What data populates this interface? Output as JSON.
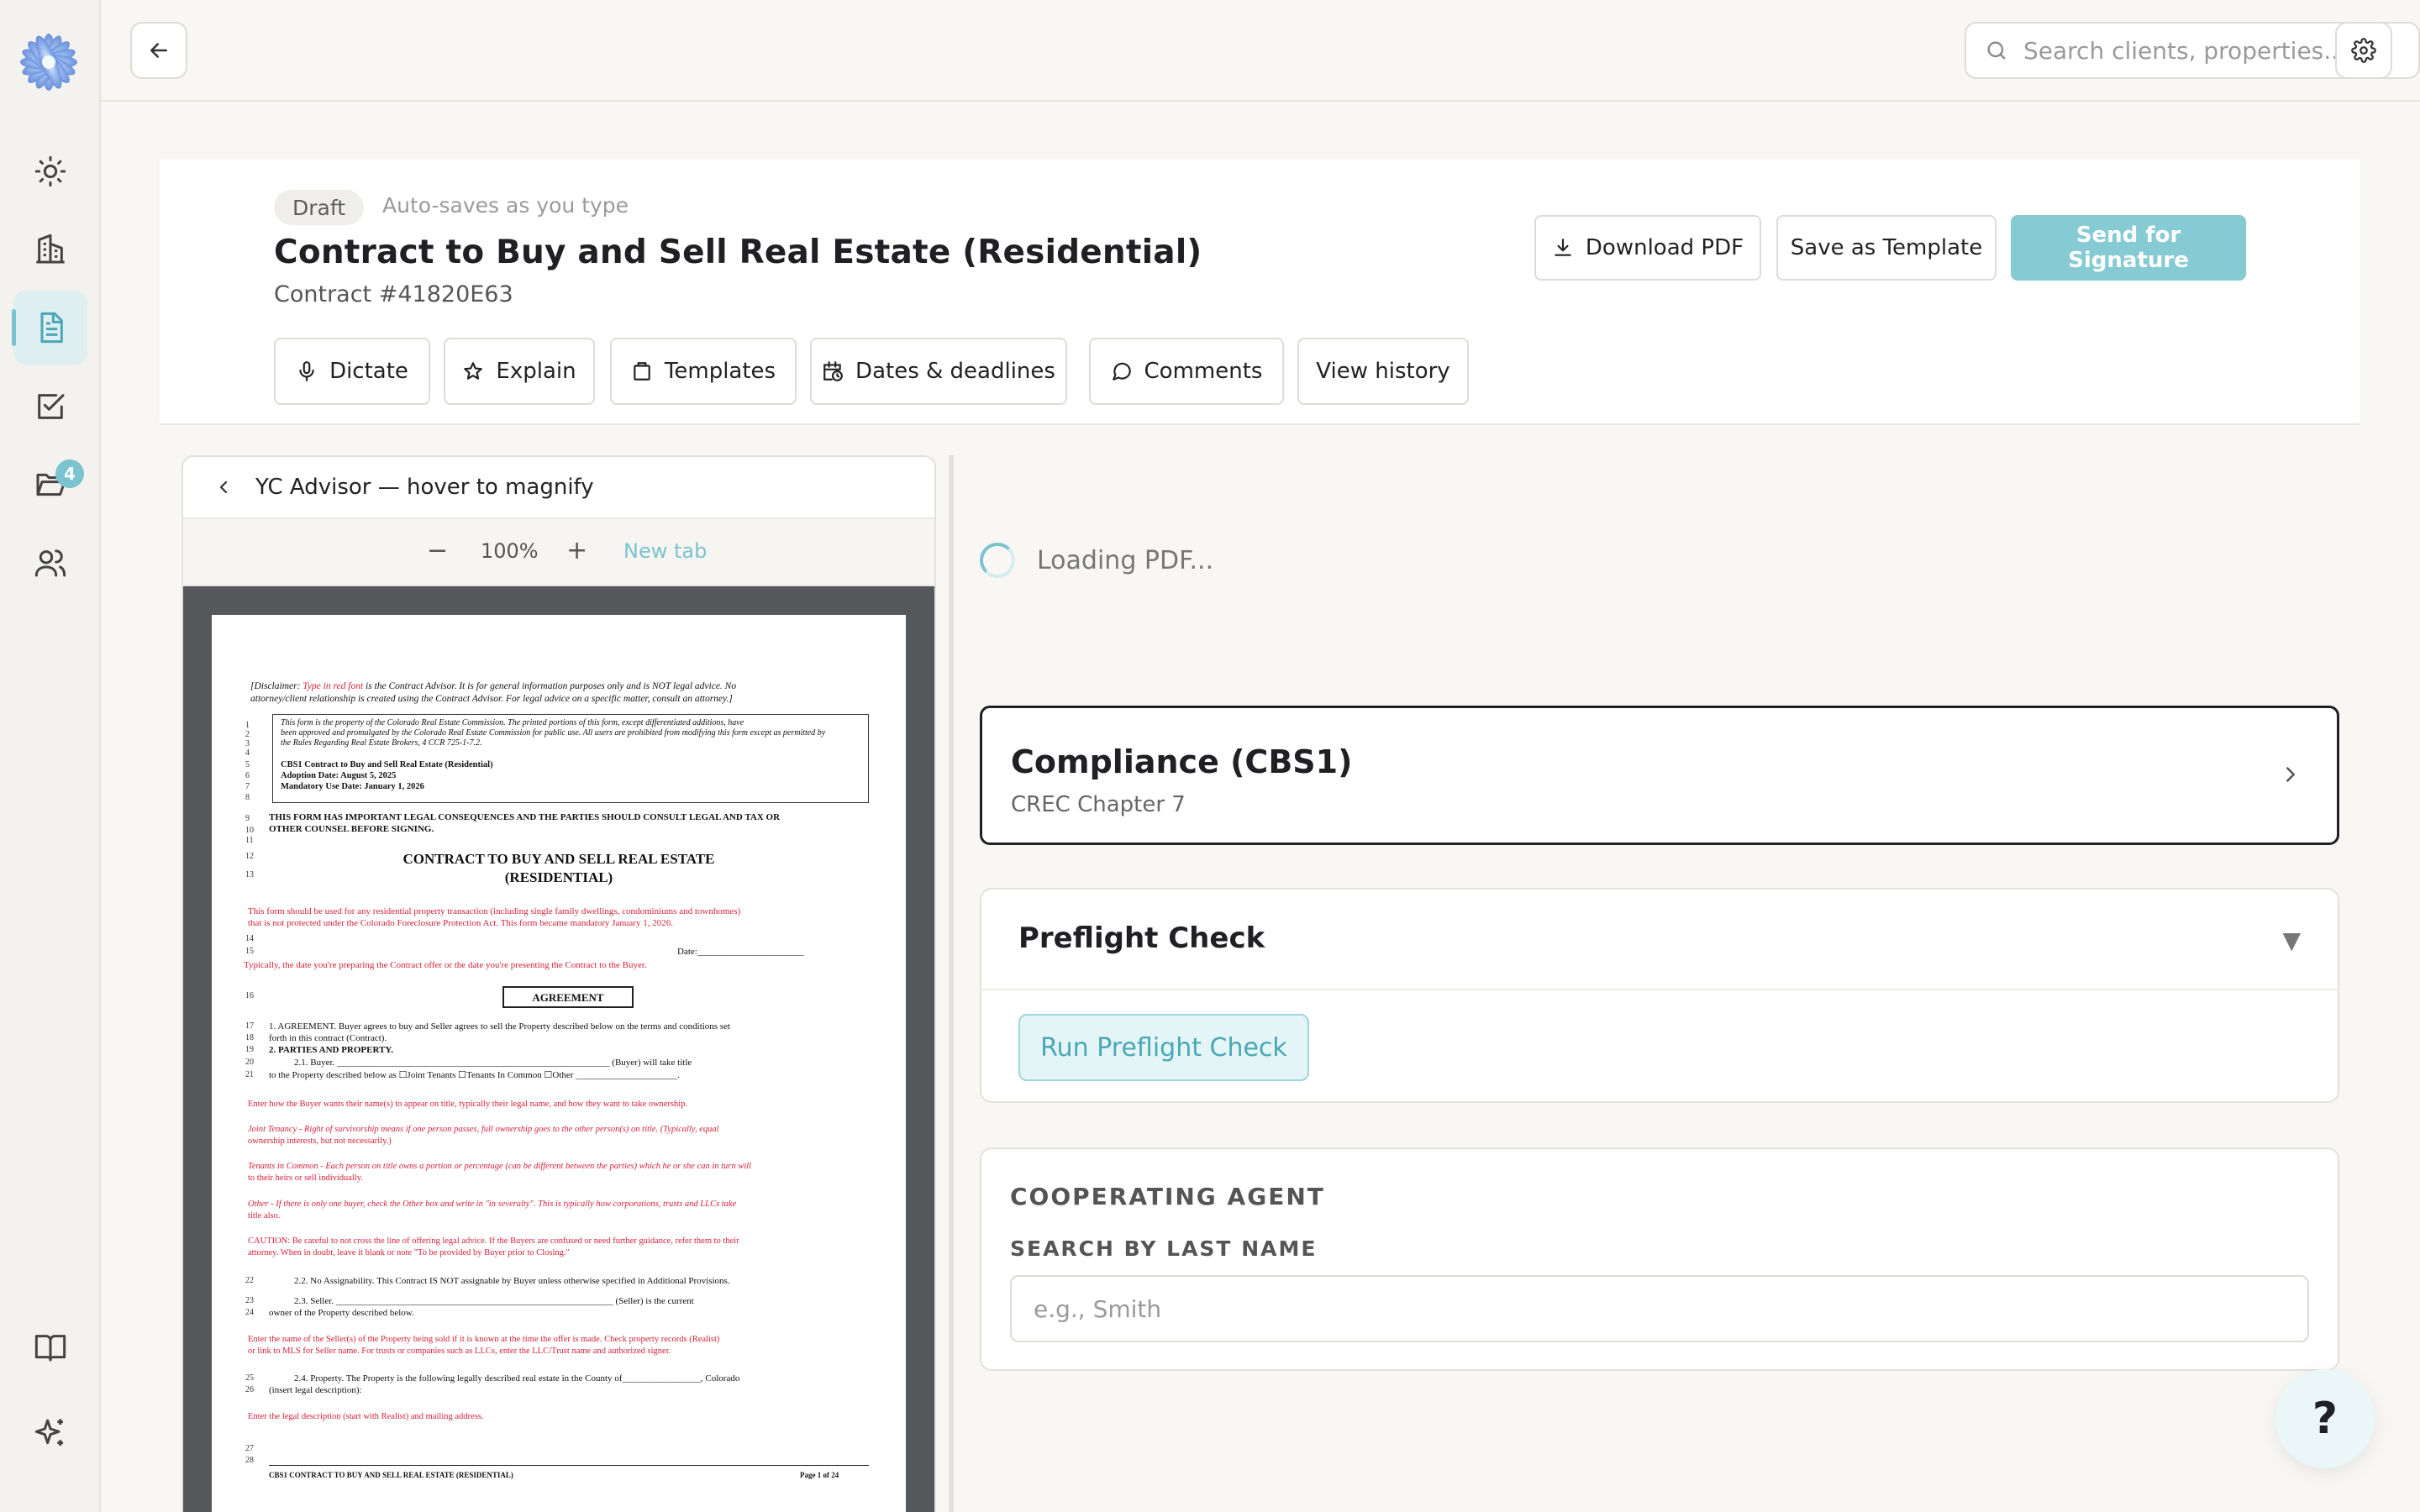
{
  "sidebar": {
    "notification_count": "4"
  },
  "search": {
    "placeholder": "Search clients, properties..."
  },
  "doc": {
    "status": "Draft",
    "autosave": "Auto-saves as you type",
    "title": "Contract to Buy and Sell Real Estate (Residential)",
    "contract_number": "Contract #41820E63"
  },
  "actions": {
    "download": "Download PDF",
    "save_template": "Save as Template",
    "send": "Send for Signature"
  },
  "tools": {
    "dictate": "Dictate",
    "explain": "Explain",
    "templates": "Templates",
    "dates": "Dates & deadlines",
    "comments": "Comments",
    "history": "View history"
  },
  "viewer": {
    "title": "YC Advisor — hover to magnify",
    "zoom_out": "−",
    "zoom": "100%",
    "zoom_in": "+",
    "new_tab": "New tab"
  },
  "pdf": {
    "disclaimer1_a": "[Disclaimer: ",
    "disclaimer1_b": "Type in red font",
    "disclaimer1_c": " is the Contract Advisor. It is for general information purposes only and is NOT legal advice. No",
    "disclaimer2": "attorney/client relationship is created using the Contract Advisor. For legal advice on a specific matter, consult an attorney.]",
    "box1": "This form is the property of the Colorado Real Estate Commission. The printed portions of this form, except differentiated additions, have",
    "box2": "been approved and promulgated by the Colorado Real Estate Commission for public use. All users are prohibited from modifying this form except as permitted by",
    "box3": "the Rules Regarding Real Estate Brokers, 4 CCR 725-1-7.2.",
    "box4": "CBS1 Contract to Buy and Sell Real Estate (Residential)",
    "box5": "Adoption Date: August 5, 2025",
    "box6": "Mandatory Use Date: January 1, 2026",
    "warn1": "THIS FORM HAS IMPORTANT LEGAL CONSEQUENCES AND THE PARTIES SHOULD CONSULT LEGAL AND TAX OR",
    "warn2": "OTHER COUNSEL BEFORE SIGNING.",
    "heading1": "CONTRACT TO BUY AND SELL REAL ESTATE",
    "heading2": "(RESIDENTIAL)",
    "red1": "This form should be used for any residential property transaction (including single family dwellings, condominiums and townhomes)",
    "red2": "that is not protected under the Colorado Foreclosure Protection Act. This form became mandatory January 1, 2026.",
    "date_label": "Date:_______________________",
    "red3": "Typically, the date you're preparing the Contract offer or the date you're presenting the Contract to the Buyer.",
    "agreement": "AGREEMENT",
    "s1": "1.     AGREEMENT.  Buyer agrees to buy and Seller agrees to sell the Property described below on the terms and conditions set",
    "s1b": "forth in this contract (Contract).",
    "s2": "2.     PARTIES AND PROPERTY.",
    "s21": "2.1.     Buyer.  ___________________________________________________________ (Buyer) will take title",
    "s21b": "to the Property described below as  ☐Joint Tenants  ☐Tenants In Common  ☐Other ______________________.",
    "red4": "Enter how the Buyer wants their name(s) to appear on title, typically their legal name, and how they want to take ownership.",
    "red5": "Joint Tenancy - Right of survivorship means if one person passes, full ownership goes to the other person(s) on title. (Typically, equal",
    "red5b": "ownership interests, but not necessarily.)",
    "red6": "Tenants in Common - Each person on title owns a portion or percentage (can be different between the parties) which he or she can in turn will",
    "red6b": "to their heirs or sell individually.",
    "red7": "Other - If there is only one buyer, check the Other box and write in \"in severalty\". This is typically how corporations, trusts and LLCs take",
    "red7b": "title also.",
    "red8": "CAUTION: Be careful to not cross the line of offering legal advice. If the Buyers are confused or need further guidance, refer them to their",
    "red8b": "attorney. When in doubt, leave it blank or note \"To be provided by Buyer prior to Closing.\"",
    "s22": "2.2.     No Assignability.  This Contract IS NOT assignable by Buyer unless otherwise specified in Additional Provisions.",
    "s23": "2.3.     Seller.  ____________________________________________________________ (Seller) is the current",
    "s23b": "owner of the Property described below.",
    "red9": "Enter the name of the Seller(s) of the Property being sold if it is known at the time the offer is made. Check property records (Realist)",
    "red9b": "or link to MLS for Seller name. For trusts or companies such as LLCs, enter the LLC/Trust name and authorized signer.",
    "s24": "2.4.     Property.  The Property is the following legally described real estate in the County of_________________, Colorado",
    "s24b": "(insert legal description):",
    "red10": "Enter the legal description (start with Realist) and mailing address.",
    "footer_left": "CBS1   CONTRACT TO BUY AND SELL REAL ESTATE (RESIDENTIAL)",
    "footer_right": "Page 1 of 24",
    "line_numbers": [
      "1",
      "2",
      "3",
      "4",
      "5",
      "6",
      "7",
      "8",
      "9",
      "10",
      "11",
      "12",
      "13",
      "14",
      "15",
      "16",
      "17",
      "18",
      "19",
      "20",
      "21",
      "22",
      "23",
      "24",
      "25",
      "26",
      "27",
      "28"
    ]
  },
  "loading_text": "Loading PDF...",
  "compliance": {
    "title": "Compliance (CBS1)",
    "subtitle": "CREC Chapter 7"
  },
  "preflight": {
    "title": "Preflight Check",
    "caret": "▼",
    "button": "Run Preflight Check"
  },
  "cooperating": {
    "heading": "COOPERATING AGENT",
    "label": "SEARCH BY LAST NAME",
    "placeholder": "e.g., Smith"
  },
  "help": "?"
}
